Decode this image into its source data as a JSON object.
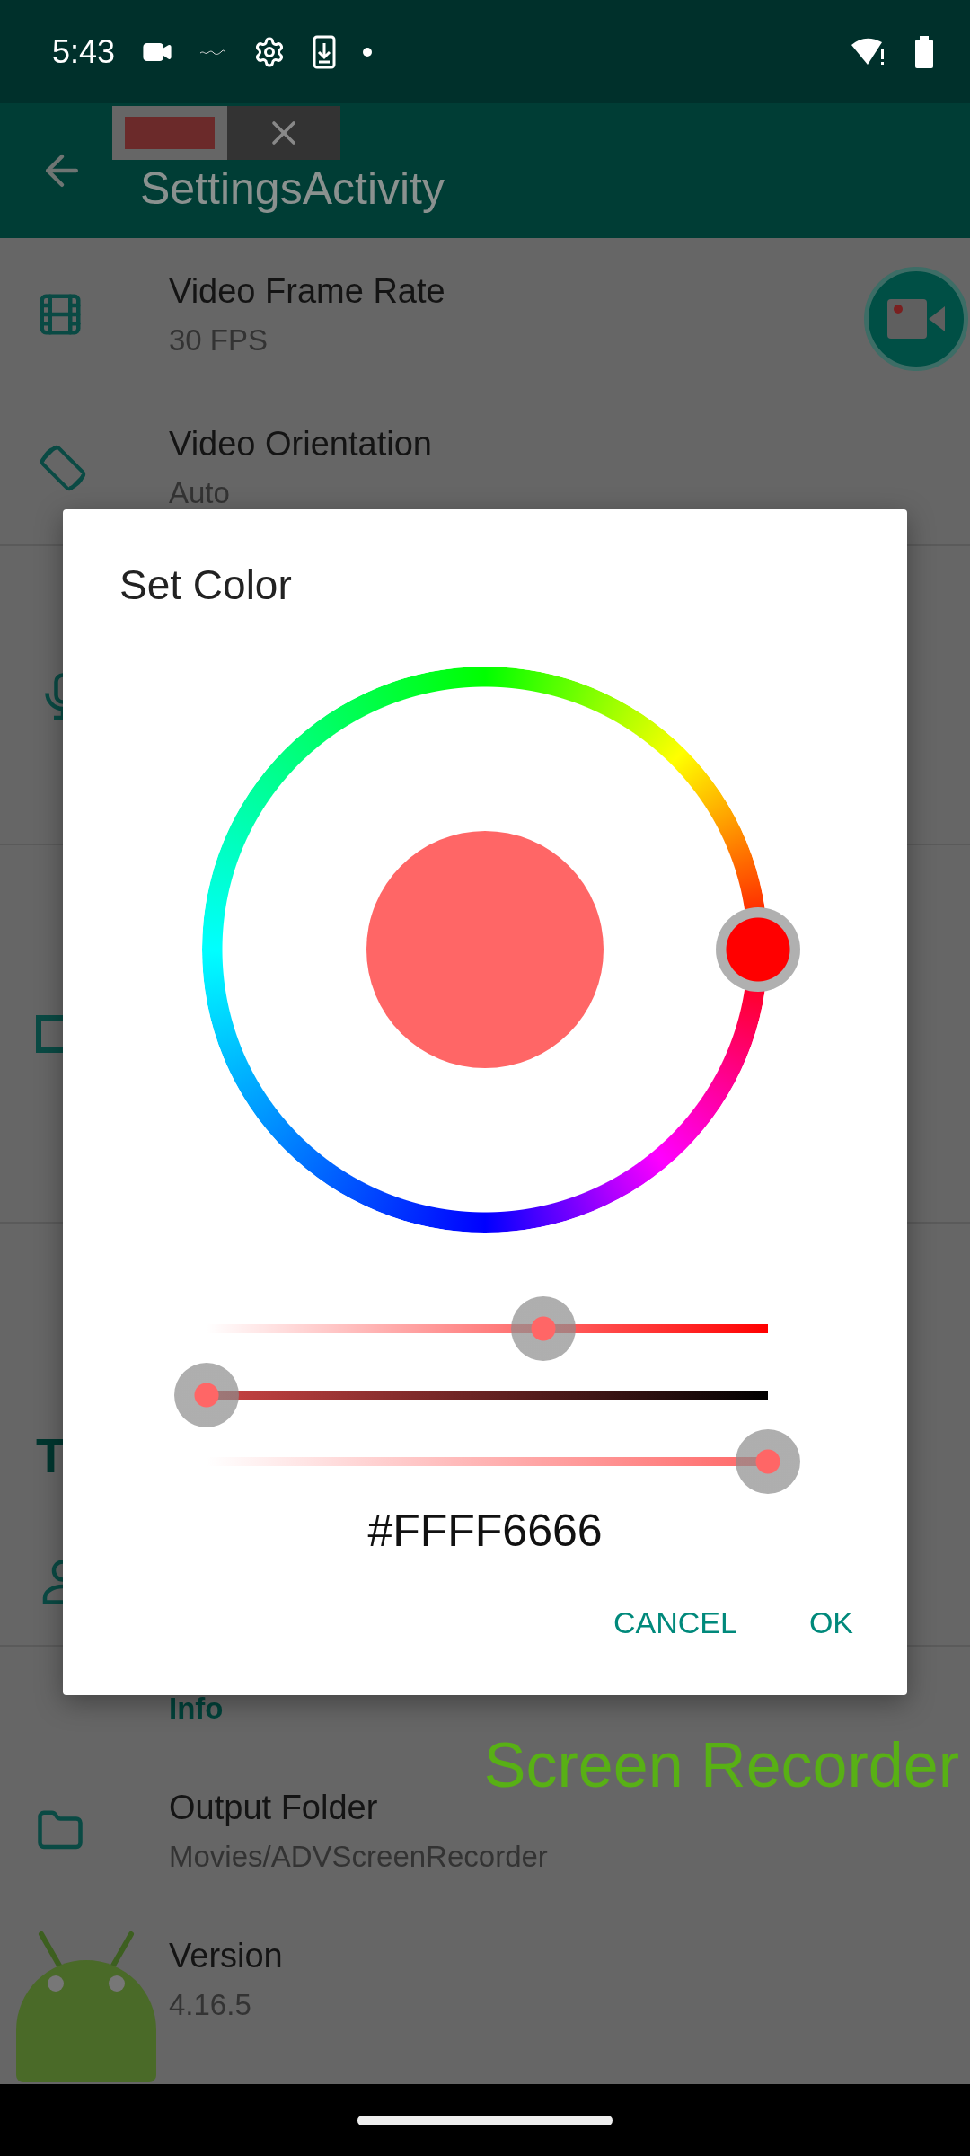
{
  "status_bar": {
    "time": "5:43"
  },
  "app_bar": {
    "title": "SettingsActivity"
  },
  "settings": [
    {
      "kind": "row",
      "title": "Video Frame Rate",
      "subtitle": "30 FPS"
    },
    {
      "kind": "row",
      "title": "Video Orientation",
      "subtitle": "Auto"
    },
    {
      "kind": "hidden-mic"
    },
    {
      "kind": "hidden-square"
    },
    {
      "kind": "hidden-header",
      "letter": "T"
    },
    {
      "kind": "header",
      "title": "Info"
    },
    {
      "kind": "row",
      "title": "Output Folder",
      "subtitle": "Movies/ADVScreenRecorder"
    },
    {
      "kind": "row",
      "title": "Version",
      "subtitle": "4.16.5"
    }
  ],
  "overlay_text": "Screen Recorder",
  "dialog": {
    "title": "Set Color",
    "swatch": {
      "color": "#ff6666"
    },
    "sliders": [
      {
        "kind": "saturation",
        "level": 0.6
      },
      {
        "kind": "value",
        "level": 0
      },
      {
        "kind": "alpha",
        "level": 1
      }
    ],
    "hex": "#FFFF6666",
    "buttons": [
      {
        "label": "CANCEL"
      },
      {
        "label": "OK"
      }
    ]
  }
}
